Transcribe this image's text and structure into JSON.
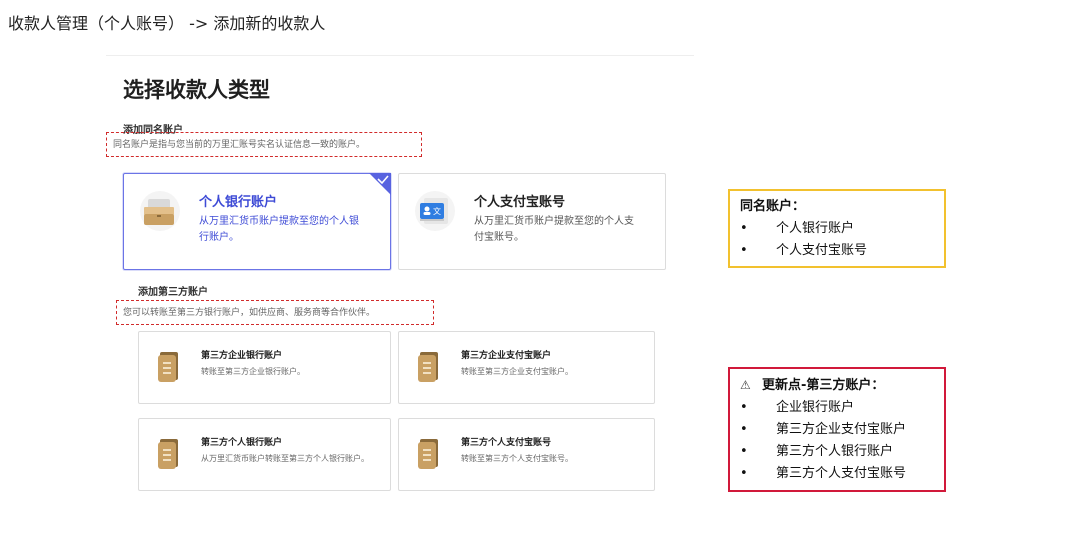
{
  "breadcrumb": "收款人管理（个人账号） -> 添加新的收款人",
  "panel": {
    "title": "选择收款人类型",
    "same_name": {
      "title": "添加同名账户",
      "desc": "同名账户是指与您当前的万里汇账号实名认证信息一致的账户。",
      "cards": [
        {
          "title": "个人银行账户",
          "desc": "从万里汇货币账户提款至您的个人银行账户。",
          "selected": true,
          "icon": "bank-card-icon"
        },
        {
          "title": "个人支付宝账号",
          "desc": "从万里汇货币账户提款至您的个人支付宝账号。",
          "selected": false,
          "icon": "alipay-id-icon"
        }
      ]
    },
    "third_party": {
      "title": "添加第三方账户",
      "desc": "您可以转账至第三方银行账户，如供应商、服务商等合作伙伴。",
      "cards": [
        {
          "title": "第三方企业银行账户",
          "desc": "转账至第三方企业银行账户。",
          "icon": "document-icon"
        },
        {
          "title": "第三方企业支付宝账户",
          "desc": "转账至第三方企业支付宝账户。",
          "icon": "document-icon"
        },
        {
          "title": "第三方个人银行账户",
          "desc": "从万里汇货币账户转账至第三方个人银行账户。",
          "icon": "document-icon"
        },
        {
          "title": "第三方个人支付宝账号",
          "desc": "转账至第三方个人支付宝账号。",
          "icon": "document-icon"
        }
      ]
    }
  },
  "callouts": {
    "same_name": {
      "title": "同名账户：",
      "items": [
        "个人银行账户",
        "个人支付宝账号"
      ]
    },
    "update": {
      "icon": "⚠",
      "title": "更新点-第三方账户：",
      "items": [
        "企业银行账户",
        "第三方企业支付宝账户",
        "第三方个人银行账户",
        "第三方个人支付宝账号"
      ]
    }
  },
  "colors": {
    "accent": "#3e4bd6",
    "selected_border": "#6b74e6",
    "annotation_red": "#d12b2b",
    "callout_yellow": "#f2c12e",
    "callout_red": "#d1193a",
    "icon_gold": "#c9a063",
    "icon_blue": "#2f7de1"
  }
}
